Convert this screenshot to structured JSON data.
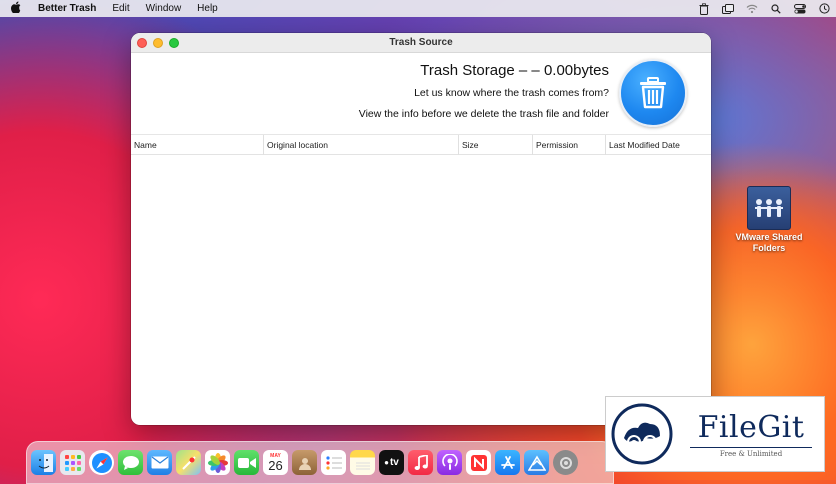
{
  "menubar": {
    "app_name": "Better Trash",
    "items": [
      "Edit",
      "Window",
      "Help"
    ]
  },
  "window": {
    "title": "Trash Source",
    "storage_text": "Trash Storage – – 0.00bytes",
    "info_line1": "Let us know where the trash comes from?",
    "info_line2": "View the info before we delete the trash file and folder",
    "columns": [
      "Name",
      "Original location",
      "Size",
      "Permission",
      "Last Modified Date"
    ]
  },
  "desktop_icon": {
    "label_line1": "VMware Shared",
    "label_line2": "Folders"
  },
  "dock": {
    "calendar_month": "MAY",
    "calendar_day": "26",
    "tv_label": "tv"
  },
  "watermark": {
    "brand": "FileGit",
    "tagline": "Free & Unlimited"
  },
  "colors": {
    "accent_blue": "#1e88f0",
    "traffic_red": "#fe5f57",
    "traffic_yellow": "#febc2e",
    "traffic_green": "#28c840"
  }
}
